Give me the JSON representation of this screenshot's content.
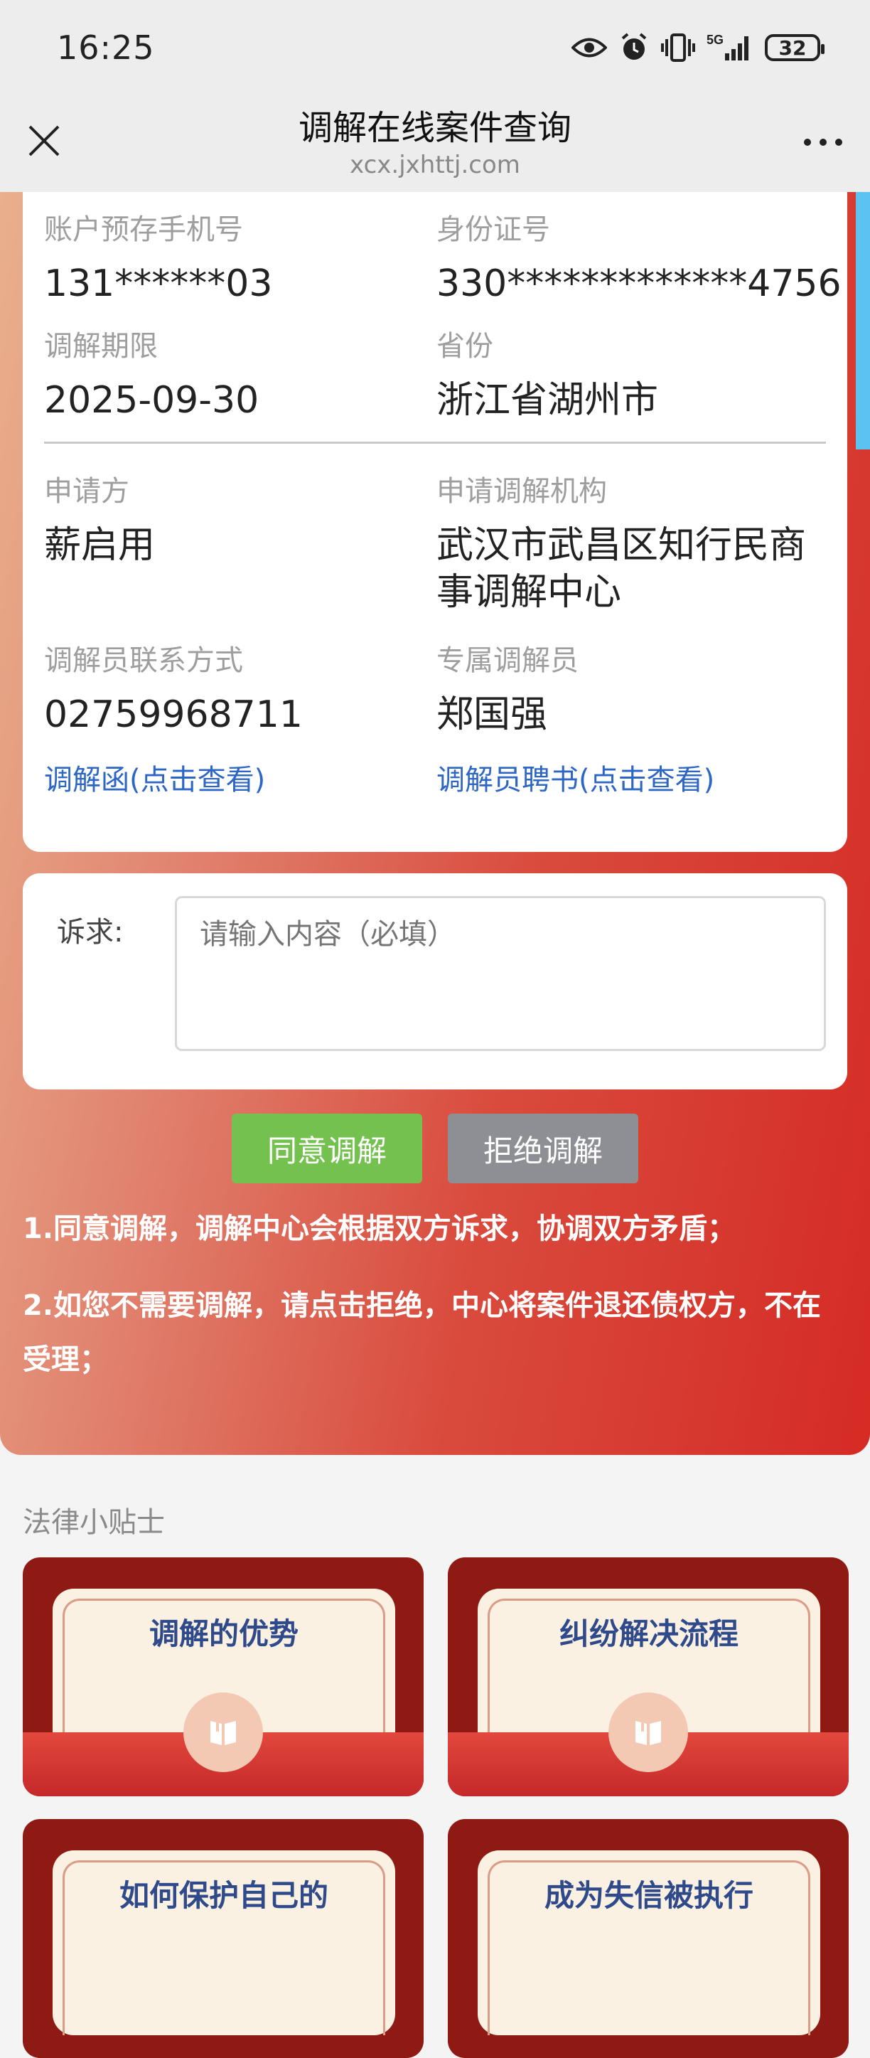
{
  "status_bar": {
    "time": "16:25",
    "network": "5G",
    "battery": "32"
  },
  "nav": {
    "title": "调解在线案件查询",
    "subtitle": "xcx.jxhttj.com"
  },
  "case": {
    "phone_label": "账户预存手机号",
    "phone": "131******03",
    "id_label": "身份证号",
    "id": "330*************4756",
    "deadline_label": "调解期限",
    "deadline": "2025-09-30",
    "province_label": "省份",
    "province": "浙江省湖州市",
    "applicant_label": "申请方",
    "applicant": "薪启用",
    "org_label": "申请调解机构",
    "org": "武汉市武昌区知行民商事调解中心",
    "contact_label": "调解员联系方式",
    "contact": "02759968711",
    "mediator_label": "专属调解员",
    "mediator": "郑国强",
    "letter_link": "调解函(点击查看)",
    "cert_link": "调解员聘书(点击查看)"
  },
  "request": {
    "label": "诉求:",
    "placeholder": "请输入内容（必填）"
  },
  "buttons": {
    "agree": "同意调解",
    "refuse": "拒绝调解"
  },
  "notes": [
    "1.同意调解，调解中心会根据双方诉求，协调双方矛盾；",
    "2.如您不需要调解，请点击拒绝，中心将案件退还债权方，不在受理；"
  ],
  "tips": {
    "title": "法律小贴士",
    "items": [
      "调解的优势",
      "纠纷解决流程",
      "如何保护自己的",
      "成为失信被执行"
    ]
  },
  "colors": {
    "accent_red": "#d52b24",
    "link_blue": "#2d66c4",
    "agree_green": "#74c14f",
    "refuse_gray": "#8e8f94",
    "scroll_blue": "#5cc2f2"
  }
}
